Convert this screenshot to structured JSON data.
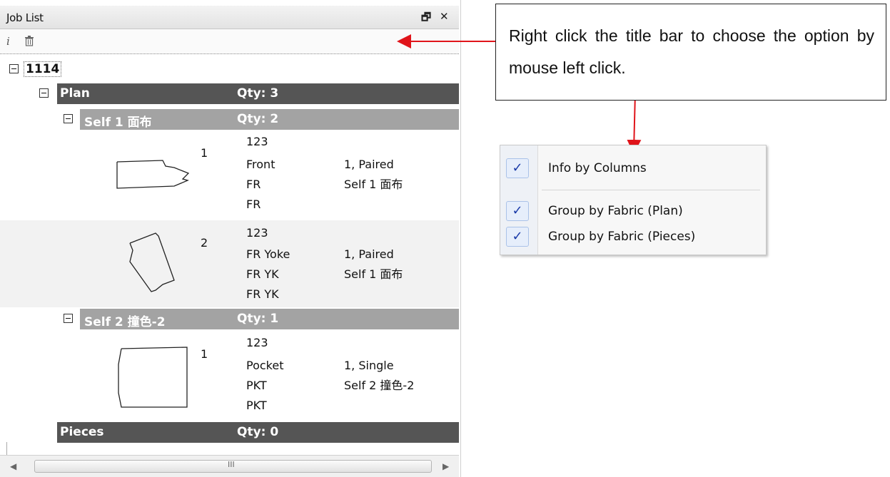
{
  "panel": {
    "title": "Job List",
    "title_buttons": {
      "float": "🗗",
      "close": "✕"
    },
    "toolbar": [
      {
        "name": "info-icon",
        "glyph": "i"
      },
      {
        "name": "delete-icon",
        "glyph": "🗑"
      }
    ]
  },
  "tree": {
    "job": "1114",
    "plan": {
      "label": "Plan",
      "qty": "Qty: 3"
    },
    "groups": [
      {
        "label": "Self 1 面布",
        "qty": "Qty: 2",
        "pieces": [
          {
            "num": "1",
            "lines": [
              "123",
              "Front",
              "FR",
              "FR"
            ],
            "info": [
              "1, Paired",
              "Self 1 面布"
            ]
          },
          {
            "num": "2",
            "lines": [
              "123",
              "FR Yoke",
              "FR YK",
              "FR YK"
            ],
            "info": [
              "1, Paired",
              "Self 1 面布"
            ]
          }
        ]
      },
      {
        "label": "Self 2 撞色-2",
        "qty": "Qty: 1",
        "pieces": [
          {
            "num": "1",
            "lines": [
              "123",
              "Pocket",
              "PKT",
              "PKT"
            ],
            "info": [
              "1, Single",
              "Self 2 撞色-2"
            ]
          }
        ]
      }
    ],
    "pieces_row": {
      "label": "Pieces",
      "qty": "Qty: 0"
    }
  },
  "scrollbar": {
    "left": "◀",
    "right": "▶",
    "grip": "III"
  },
  "callout": {
    "text": "Right click the title bar to choose the option by mouse left click."
  },
  "menu": {
    "items": [
      {
        "label": "Info by Columns",
        "checked": "✓"
      },
      {
        "label": "Group by Fabric (Plan)",
        "checked": "✓"
      },
      {
        "label": "Group by Fabric (Pieces)",
        "checked": "✓"
      }
    ]
  },
  "colors": {
    "arrow": "#e0141a",
    "row_dark": "#555555",
    "row_mid": "#a3a3a3"
  }
}
